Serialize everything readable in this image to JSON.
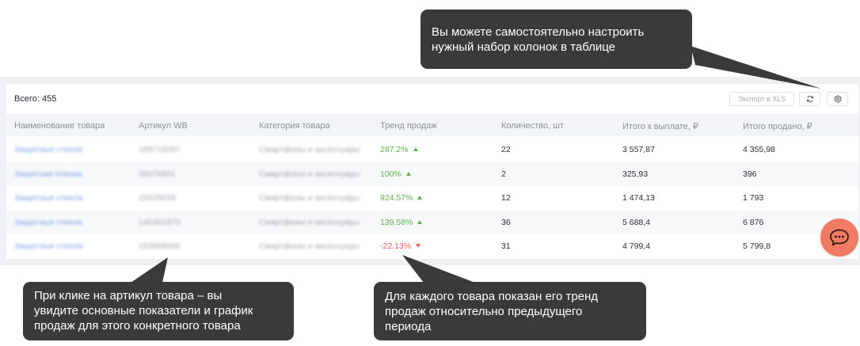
{
  "summary": {
    "total": "Всего: 455"
  },
  "toolbar": {
    "export_label": "Экспорт в XLS",
    "refresh_icon": "refresh-icon",
    "settings_icon": "gear-icon"
  },
  "table": {
    "headers": [
      "Наименование товара",
      "Артикул WB",
      "Категория товара",
      "Тренд продаж",
      "Количество, шт",
      "Итого к выплате, ₽",
      "Итого продано, ₽"
    ],
    "rows": [
      {
        "name": "Защитные стекла",
        "article": "169719297",
        "category": "Смартфоны и аксессуары",
        "trend": "287.2%",
        "trend_dir": "up",
        "qty": "22",
        "payout": "3 557,87",
        "sold": "4 355,98"
      },
      {
        "name": "Защитная пленка",
        "article": "35076931",
        "category": "Смартфоны и аксессуары",
        "trend": "100%",
        "trend_dir": "up",
        "qty": "2",
        "payout": "325,93",
        "sold": "396"
      },
      {
        "name": "Защитные стекла",
        "article": "25529028",
        "category": "Смартфоны и аксессуары",
        "trend": "924.57%",
        "trend_dir": "up",
        "qty": "12",
        "payout": "1 474,13",
        "sold": "1 793"
      },
      {
        "name": "Защитные стекла",
        "article": "140351879",
        "category": "Смартфоны и аксессуары",
        "trend": "139.58%",
        "trend_dir": "up",
        "qty": "36",
        "payout": "5 688,4",
        "sold": "6 876"
      },
      {
        "name": "Защитные стекла",
        "article": "153998066",
        "category": "Смартфоны и аксессуары",
        "trend": "-22.13%",
        "trend_dir": "down",
        "qty": "31",
        "payout": "4 799,4",
        "sold": "5 799,8"
      }
    ]
  },
  "callouts": {
    "columns": [
      "Вы можете самостоятельно настроить",
      "нужный набор колонок в таблице"
    ],
    "article": [
      "При клике на артикул товара – вы",
      "увидите основные показатели и график",
      "продаж для этого конкретного товара"
    ],
    "trend": [
      "Для каждого товара показан его тренд",
      "продаж относительно предыдущего",
      "периода"
    ]
  },
  "chat": {
    "icon": "chat-bubble-icon"
  },
  "colors": {
    "link": "#5d8ee6",
    "trend_up": "#5fb14f",
    "trend_down": "#ec5b58",
    "callout_bg": "#3a3a3a",
    "chat_button": "#f07b63"
  }
}
